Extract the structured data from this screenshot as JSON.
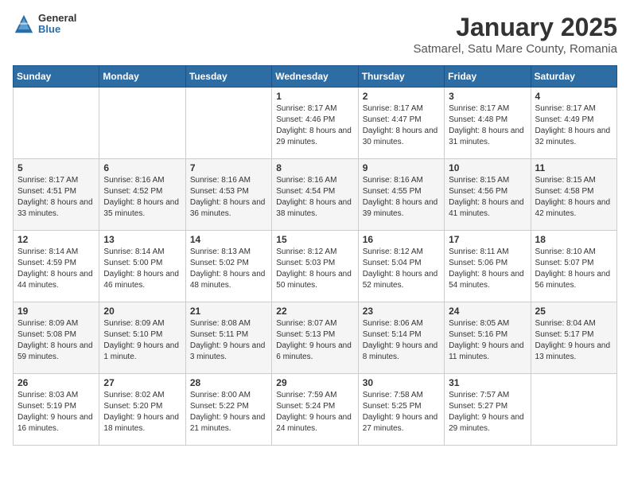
{
  "logo": {
    "general": "General",
    "blue": "Blue"
  },
  "title": "January 2025",
  "subtitle": "Satmarel, Satu Mare County, Romania",
  "weekdays": [
    "Sunday",
    "Monday",
    "Tuesday",
    "Wednesday",
    "Thursday",
    "Friday",
    "Saturday"
  ],
  "weeks": [
    [
      {
        "day": "",
        "sunrise": "",
        "sunset": "",
        "daylight": ""
      },
      {
        "day": "",
        "sunrise": "",
        "sunset": "",
        "daylight": ""
      },
      {
        "day": "",
        "sunrise": "",
        "sunset": "",
        "daylight": ""
      },
      {
        "day": "1",
        "sunrise": "Sunrise: 8:17 AM",
        "sunset": "Sunset: 4:46 PM",
        "daylight": "Daylight: 8 hours and 29 minutes."
      },
      {
        "day": "2",
        "sunrise": "Sunrise: 8:17 AM",
        "sunset": "Sunset: 4:47 PM",
        "daylight": "Daylight: 8 hours and 30 minutes."
      },
      {
        "day": "3",
        "sunrise": "Sunrise: 8:17 AM",
        "sunset": "Sunset: 4:48 PM",
        "daylight": "Daylight: 8 hours and 31 minutes."
      },
      {
        "day": "4",
        "sunrise": "Sunrise: 8:17 AM",
        "sunset": "Sunset: 4:49 PM",
        "daylight": "Daylight: 8 hours and 32 minutes."
      }
    ],
    [
      {
        "day": "5",
        "sunrise": "Sunrise: 8:17 AM",
        "sunset": "Sunset: 4:51 PM",
        "daylight": "Daylight: 8 hours and 33 minutes."
      },
      {
        "day": "6",
        "sunrise": "Sunrise: 8:16 AM",
        "sunset": "Sunset: 4:52 PM",
        "daylight": "Daylight: 8 hours and 35 minutes."
      },
      {
        "day": "7",
        "sunrise": "Sunrise: 8:16 AM",
        "sunset": "Sunset: 4:53 PM",
        "daylight": "Daylight: 8 hours and 36 minutes."
      },
      {
        "day": "8",
        "sunrise": "Sunrise: 8:16 AM",
        "sunset": "Sunset: 4:54 PM",
        "daylight": "Daylight: 8 hours and 38 minutes."
      },
      {
        "day": "9",
        "sunrise": "Sunrise: 8:16 AM",
        "sunset": "Sunset: 4:55 PM",
        "daylight": "Daylight: 8 hours and 39 minutes."
      },
      {
        "day": "10",
        "sunrise": "Sunrise: 8:15 AM",
        "sunset": "Sunset: 4:56 PM",
        "daylight": "Daylight: 8 hours and 41 minutes."
      },
      {
        "day": "11",
        "sunrise": "Sunrise: 8:15 AM",
        "sunset": "Sunset: 4:58 PM",
        "daylight": "Daylight: 8 hours and 42 minutes."
      }
    ],
    [
      {
        "day": "12",
        "sunrise": "Sunrise: 8:14 AM",
        "sunset": "Sunset: 4:59 PM",
        "daylight": "Daylight: 8 hours and 44 minutes."
      },
      {
        "day": "13",
        "sunrise": "Sunrise: 8:14 AM",
        "sunset": "Sunset: 5:00 PM",
        "daylight": "Daylight: 8 hours and 46 minutes."
      },
      {
        "day": "14",
        "sunrise": "Sunrise: 8:13 AM",
        "sunset": "Sunset: 5:02 PM",
        "daylight": "Daylight: 8 hours and 48 minutes."
      },
      {
        "day": "15",
        "sunrise": "Sunrise: 8:12 AM",
        "sunset": "Sunset: 5:03 PM",
        "daylight": "Daylight: 8 hours and 50 minutes."
      },
      {
        "day": "16",
        "sunrise": "Sunrise: 8:12 AM",
        "sunset": "Sunset: 5:04 PM",
        "daylight": "Daylight: 8 hours and 52 minutes."
      },
      {
        "day": "17",
        "sunrise": "Sunrise: 8:11 AM",
        "sunset": "Sunset: 5:06 PM",
        "daylight": "Daylight: 8 hours and 54 minutes."
      },
      {
        "day": "18",
        "sunrise": "Sunrise: 8:10 AM",
        "sunset": "Sunset: 5:07 PM",
        "daylight": "Daylight: 8 hours and 56 minutes."
      }
    ],
    [
      {
        "day": "19",
        "sunrise": "Sunrise: 8:09 AM",
        "sunset": "Sunset: 5:08 PM",
        "daylight": "Daylight: 8 hours and 59 minutes."
      },
      {
        "day": "20",
        "sunrise": "Sunrise: 8:09 AM",
        "sunset": "Sunset: 5:10 PM",
        "daylight": "Daylight: 9 hours and 1 minute."
      },
      {
        "day": "21",
        "sunrise": "Sunrise: 8:08 AM",
        "sunset": "Sunset: 5:11 PM",
        "daylight": "Daylight: 9 hours and 3 minutes."
      },
      {
        "day": "22",
        "sunrise": "Sunrise: 8:07 AM",
        "sunset": "Sunset: 5:13 PM",
        "daylight": "Daylight: 9 hours and 6 minutes."
      },
      {
        "day": "23",
        "sunrise": "Sunrise: 8:06 AM",
        "sunset": "Sunset: 5:14 PM",
        "daylight": "Daylight: 9 hours and 8 minutes."
      },
      {
        "day": "24",
        "sunrise": "Sunrise: 8:05 AM",
        "sunset": "Sunset: 5:16 PM",
        "daylight": "Daylight: 9 hours and 11 minutes."
      },
      {
        "day": "25",
        "sunrise": "Sunrise: 8:04 AM",
        "sunset": "Sunset: 5:17 PM",
        "daylight": "Daylight: 9 hours and 13 minutes."
      }
    ],
    [
      {
        "day": "26",
        "sunrise": "Sunrise: 8:03 AM",
        "sunset": "Sunset: 5:19 PM",
        "daylight": "Daylight: 9 hours and 16 minutes."
      },
      {
        "day": "27",
        "sunrise": "Sunrise: 8:02 AM",
        "sunset": "Sunset: 5:20 PM",
        "daylight": "Daylight: 9 hours and 18 minutes."
      },
      {
        "day": "28",
        "sunrise": "Sunrise: 8:00 AM",
        "sunset": "Sunset: 5:22 PM",
        "daylight": "Daylight: 9 hours and 21 minutes."
      },
      {
        "day": "29",
        "sunrise": "Sunrise: 7:59 AM",
        "sunset": "Sunset: 5:24 PM",
        "daylight": "Daylight: 9 hours and 24 minutes."
      },
      {
        "day": "30",
        "sunrise": "Sunrise: 7:58 AM",
        "sunset": "Sunset: 5:25 PM",
        "daylight": "Daylight: 9 hours and 27 minutes."
      },
      {
        "day": "31",
        "sunrise": "Sunrise: 7:57 AM",
        "sunset": "Sunset: 5:27 PM",
        "daylight": "Daylight: 9 hours and 29 minutes."
      },
      {
        "day": "",
        "sunrise": "",
        "sunset": "",
        "daylight": ""
      }
    ]
  ]
}
